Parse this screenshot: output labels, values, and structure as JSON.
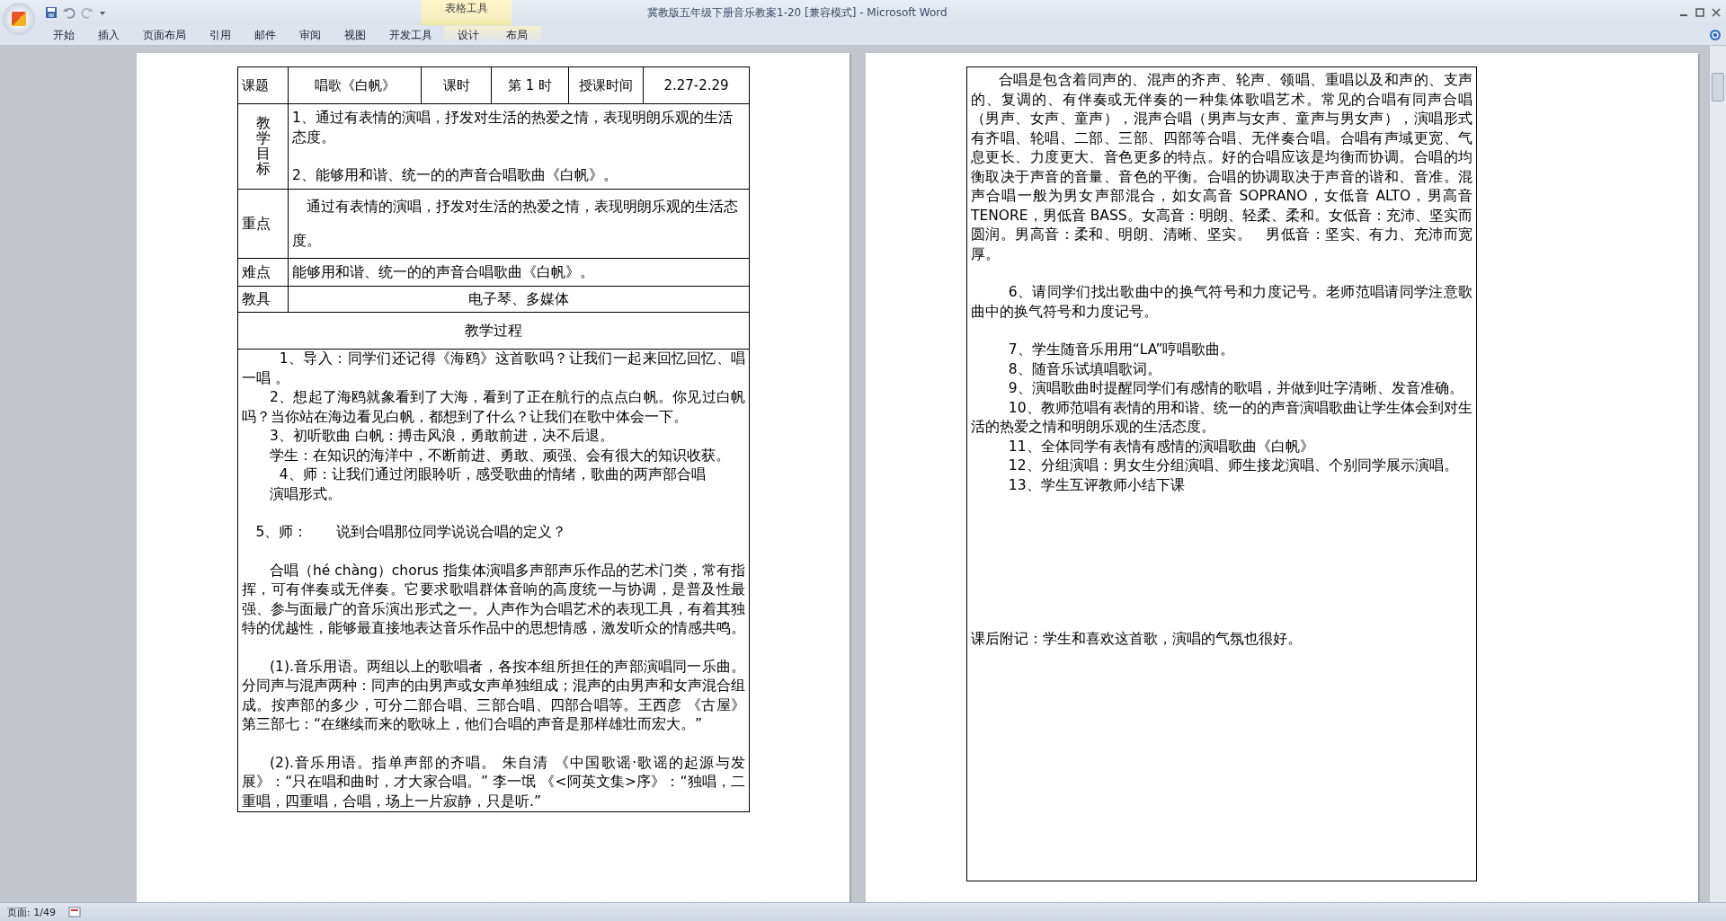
{
  "window": {
    "title": "冀教版五年级下册音乐教案1-20 [兼容模式] - Microsoft Word",
    "context_group": "表格工具"
  },
  "ribbon_tabs": [
    {
      "label": "开始",
      "selected": false,
      "contextual": false
    },
    {
      "label": "插入",
      "selected": false,
      "contextual": false
    },
    {
      "label": "页面布局",
      "selected": false,
      "contextual": false
    },
    {
      "label": "引用",
      "selected": false,
      "contextual": false
    },
    {
      "label": "邮件",
      "selected": false,
      "contextual": false
    },
    {
      "label": "审阅",
      "selected": false,
      "contextual": false
    },
    {
      "label": "视图",
      "selected": false,
      "contextual": false
    },
    {
      "label": "开发工具",
      "selected": false,
      "contextual": false
    },
    {
      "label": "设计",
      "selected": false,
      "contextual": true
    },
    {
      "label": "布局",
      "selected": false,
      "contextual": true
    }
  ],
  "lesson_table": {
    "header": [
      "课题",
      "唱歌《白帆》",
      "课时",
      "第 1 时",
      "授课时间",
      "2.27-2.29"
    ],
    "rows": [
      {
        "label": "教学目标",
        "kind": "objectives",
        "paragraphs": [
          "1、通过有表情的演唱，抒发对生活的热爱之情，表现明朗乐观的生活态度。",
          "2、能够用和谐、统一的的声音合唱歌曲《白帆》。"
        ]
      },
      {
        "label": "重点",
        "kind": "focus",
        "paragraphs": [
          "通过有表情的演唱，抒发对生活的热爱之情，表现明朗乐观的生活态度。"
        ]
      },
      {
        "label": "难点",
        "kind": "plain",
        "paragraphs": [
          "能够用和谐、统一的的声音合唱歌曲《白帆》。"
        ]
      },
      {
        "label": "教具",
        "kind": "centered",
        "paragraphs": [
          "电子琴、多媒体"
        ]
      }
    ],
    "process_heading": "教学过程",
    "process": [
      {
        "text": "1、导入：同学们还记得《海鸥》这首歌吗？让我们一起来回忆回忆、唱一唱 。",
        "kind": "wide",
        "space_before": false
      },
      {
        "text": "2、想起了海鸥就象看到了大海，看到了正在航行的点点白帆。你见过白帆吗？当你站在海边看见白帆，都想到了什么？让我们在歌中体会一下。",
        "kind": "normal",
        "space_before": false
      },
      {
        "text": "3、初听歌曲 白帆：搏击风浪，勇敢前进，决不后退。",
        "kind": "normal",
        "space_before": false
      },
      {
        "text": "学生：在知识的海洋中，不断前进、勇敢、顽强、会有很大的知识收获。",
        "kind": "normal",
        "space_before": false
      },
      {
        "text": "4、师：让我们通过闭眼聆听，感受歌曲的情绪，歌曲的两声部合唱",
        "kind": "wide",
        "space_before": false
      },
      {
        "text": "演唱形式。",
        "kind": "normal",
        "space_before": false
      },
      {
        "text": "5、师：　　说到合唱那位同学说说合唱的定义？",
        "kind": "small",
        "space_before": true
      },
      {
        "text": "合唱（hé chàng）chorus 指集体演唱多声部声乐作品的艺术门类，常有指挥，可有伴奏或无伴奏。它要求歌唱群体音响的高度统一与协调，是普及性最强、参与面最广的音乐演出形式之一。人声作为合唱艺术的表现工具，有着其独特的优越性，能够最直接地表达音乐作品中的思想情感，激发听众的情感共鸣。",
        "kind": "normal",
        "space_before": true
      },
      {
        "text": "(1).音乐用语。两组以上的歌唱者，各按本组所担任的声部演唱同一乐曲。分同声与混声两种：同声的由男声或女声单独组成；混声的由男声和女声混合组成。按声部的多少，可分二部合唱、三部合唱、四部合唱等。王西彦 《古屋》第三部七：“在继续而来的歌咏上，他们合唱的声音是那样雄壮而宏大。”",
        "kind": "normal",
        "space_before": true
      },
      {
        "text": "(2).音乐用语。指单声部的齐唱。 朱自清 《中国歌谣·歌谣的起源与发展》：“只在唱和曲时，才大家合唱。” 李一氓 《<阿英文集>序》：“独唱，二重唱，四重唱，合唱，场上一片寂静，只是听.”",
        "kind": "normal",
        "space_before": true
      }
    ]
  },
  "continuation": {
    "paragraphs": [
      {
        "text": "合唱是包含着同声的、混声的齐声、轮声、领唱、重唱以及和声的、支声的、复调的、有伴奏或无伴奏的一种集体歌唱艺术。常见的合唱有同声合唱（男声、女声、童声），混声合唱（男声与女声、童声与男女声），演唱形式有齐唱、轮唱、二部、三部、四部等合唱、无伴奏合唱。合唱有声域更宽、气息更长、力度更大、音色更多的特点。好的合唱应该是均衡而协调。合唱的均衡取决于声音的音量、音色的平衡。合唱的协调取决于声音的谐和、音准。混声合唱一般为男女声部混合，如女高音 SOPRANO，女低音 ALTO，男高音 TENORE，男低音 BASS。女高音：明朗、轻柔、柔和。女低音：充沛、坚实而圆润。男高音：柔和、明朗、清晰、坚实。　男低音：坚实、有力、充沛而宽厚。",
        "kind": "normal",
        "space_before": false
      },
      {
        "text": "6、请同学们找出歌曲中的换气符号和力度记号。老师范唱请同学注意歌曲中的换气符号和力度记号。",
        "kind": "wide",
        "space_before": true
      },
      {
        "text": "7、学生随音乐用用“LA”哼唱歌曲。",
        "kind": "wide",
        "space_before": true
      },
      {
        "text": "8、随音乐试填唱歌词。",
        "kind": "wide",
        "space_before": false
      },
      {
        "text": "9、演唱歌曲时提醒同学们有感情的歌唱，并做到吐字清晰、发音准确。",
        "kind": "wide",
        "space_before": false
      },
      {
        "text": "10、教师范唱有表情的用和谐、统一的的声音演唱歌曲让学生体会到对生活的热爱之情和明朗乐观的生活态度。",
        "kind": "wide",
        "space_before": false
      },
      {
        "text": "11、全体同学有表情有感情的演唱歌曲《白帆》",
        "kind": "wide",
        "space_before": false
      },
      {
        "text": "12、分组演唱：男女生分组演唱、师生接龙演唱、个别同学展示演唱。",
        "kind": "wide",
        "space_before": false
      },
      {
        "text": "13、学生互评教师小结下课",
        "kind": "wide",
        "space_before": false
      }
    ],
    "postscript": "课后附记：学生和喜欢这首歌，演唱的气氛也很好。"
  },
  "status_bar": {
    "page": "页面: 1/49"
  }
}
